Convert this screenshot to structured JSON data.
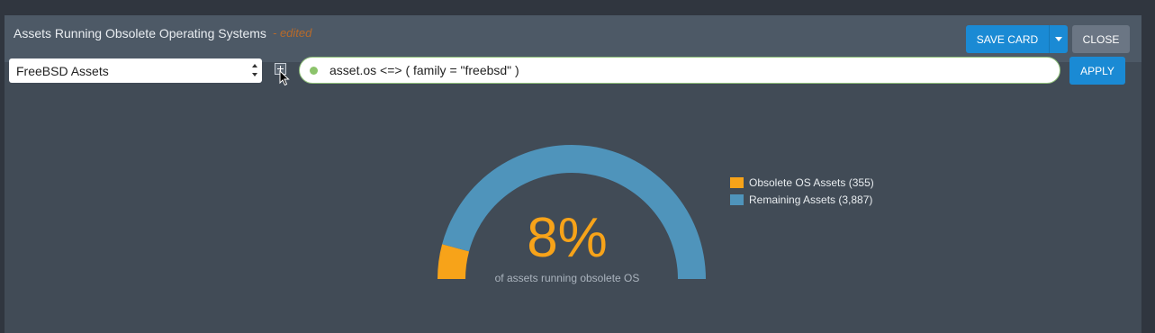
{
  "card": {
    "title": "Assets Running Obsolete Operating Systems",
    "edited_label": "- edited",
    "save_label": "SAVE CARD",
    "close_label": "CLOSE"
  },
  "filter": {
    "selected_group": "FreeBSD Assets",
    "query": "asset.os <=> ( family = \"freebsd\" )",
    "apply_label": "APPLY"
  },
  "chart_data": {
    "type": "pie",
    "style": "half-donut gauge",
    "categories": [
      "Obsolete OS Assets (355)",
      "Remaining Assets (3,887)"
    ],
    "values": [
      355,
      3887
    ],
    "colors": [
      "#f7a319",
      "#4f94bb"
    ],
    "center_value": "8%",
    "center_caption": "of assets running obsolete OS",
    "legend_placement": "right"
  },
  "icons": {
    "expand": "plus-square-icon",
    "cursor": "mouse-pointer-icon",
    "status": "valid-status-dot-icon"
  }
}
